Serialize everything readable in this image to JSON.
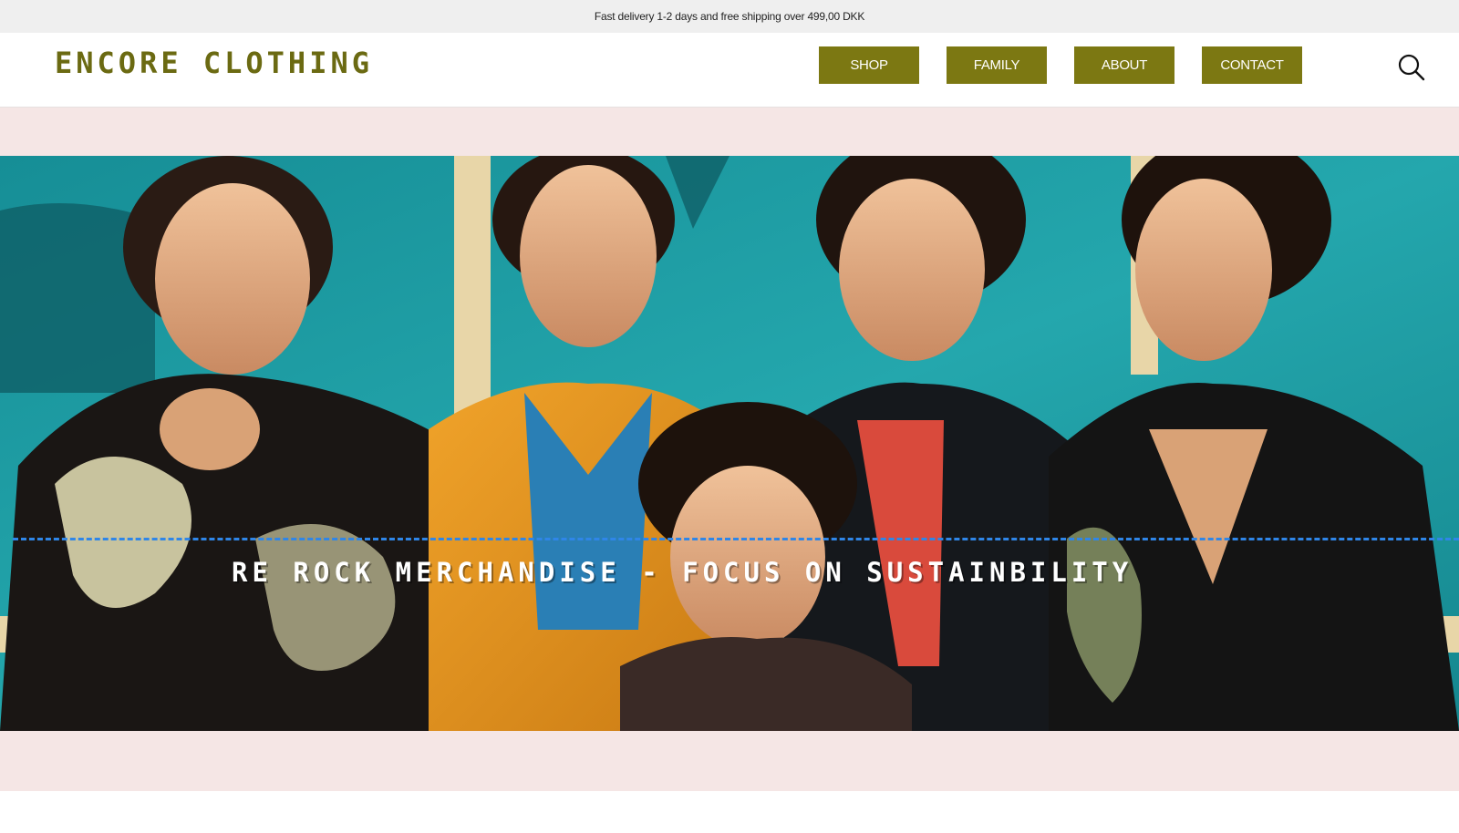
{
  "announcement": {
    "text": "Fast delivery 1-2 days and free shipping over 499,00 DKK"
  },
  "header": {
    "logo": "ENCORE CLOTHING",
    "nav": {
      "shop": "SHOP",
      "family": "FAMILY",
      "about": "ABOUT",
      "contact": "CONTACT"
    },
    "search_icon": "search-icon"
  },
  "hero": {
    "marquee_text": "RE ROCK MERCHANDISE - FOCUS ON SUSTAINBILITY"
  },
  "colors": {
    "accent": "#7c7812",
    "logo": "#6b6a12",
    "pink_band": "#f5e6e5",
    "announcement_bg": "#efefef",
    "hero_bg": "#1d9aa0",
    "marquee_line": "#2f86e8"
  }
}
